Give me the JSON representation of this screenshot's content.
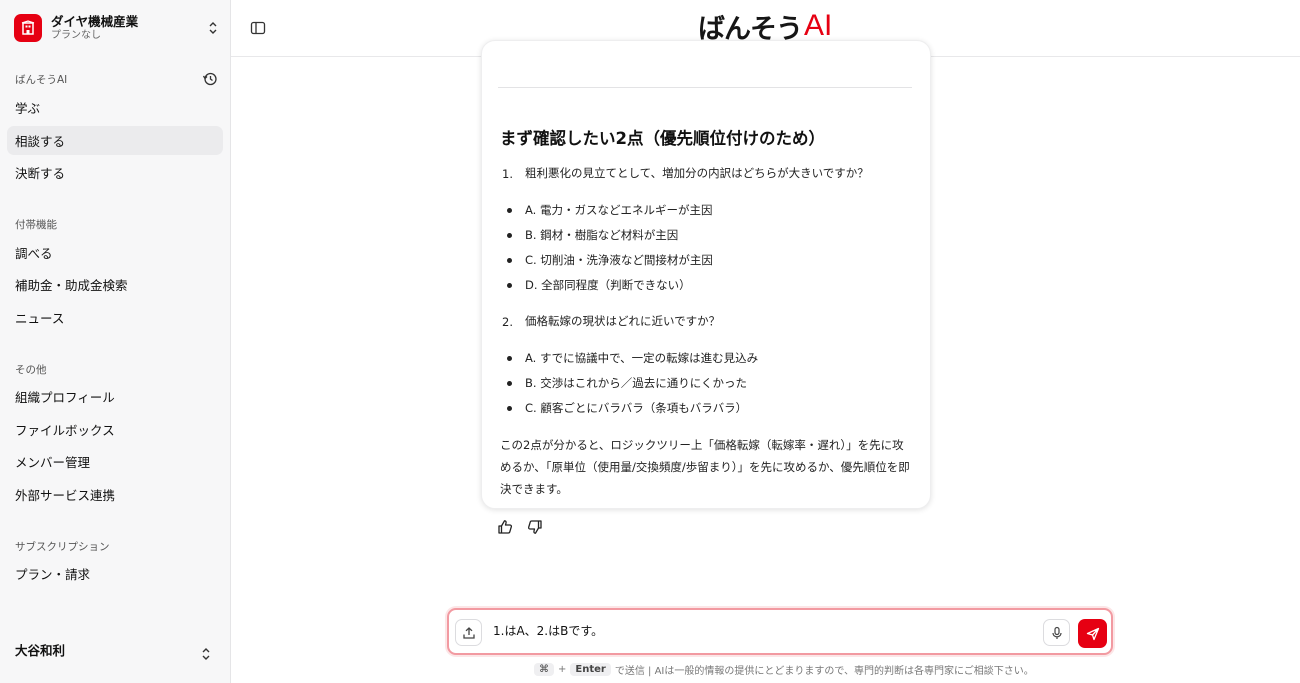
{
  "org": {
    "name": "ダイヤ機械産業",
    "plan": "プランなし"
  },
  "sidebar": {
    "section_main": "ばんそうAI",
    "main_items": [
      {
        "label": "学ぶ"
      },
      {
        "label": "相談する"
      },
      {
        "label": "決断する"
      }
    ],
    "section_extra": "付帯機能",
    "extra_items": [
      {
        "label": "調べる"
      },
      {
        "label": "補助金・助成金検索"
      },
      {
        "label": "ニュース"
      }
    ],
    "section_other": "その他",
    "other_items": [
      {
        "label": "組織プロフィール"
      },
      {
        "label": "ファイルボックス"
      },
      {
        "label": "メンバー管理"
      },
      {
        "label": "外部サービス連携"
      }
    ],
    "section_sub": "サブスクリプション",
    "sub_items": [
      {
        "label": "プラン・請求"
      }
    ],
    "user_name": "大谷和利"
  },
  "header": {
    "brand_kana": "ばんそう",
    "brand_ai": "AI"
  },
  "message": {
    "heading": "まず確認したい2点（優先順位付けのため）",
    "q1_num": "1.",
    "q1": "粗利悪化の見立てとして、増加分の内訳はどちらが大きいですか？",
    "q1_options": [
      "A. 電力・ガスなどエネルギーが主因",
      "B. 鋼材・樹脂など材料が主因",
      "C. 切削油・洗浄液など間接材が主因",
      "D. 全部同程度（判断できない）"
    ],
    "q2_num": "2.",
    "q2": "価格転嫁の現状はどれに近いですか？",
    "q2_options": [
      "A. すでに協議中で、一定の転嫁は進む見込み",
      "B. 交渉はこれから／過去に通りにくかった",
      "C. 顧客ごとにバラバラ（条項もバラバラ）"
    ],
    "closing": "この2点が分かると、ロジックツリー上「価格転嫁（転嫁率・遅れ）」を先に攻めるか、「原単位（使用量/交換頻度/歩留まり）」を先に攻めるか、優先順位を即決できます。"
  },
  "composer": {
    "value": "1.はA、2.はBです。",
    "hint_key1": "⌘",
    "hint_plus": "+",
    "hint_key2": "Enter",
    "hint_text": "で送信 | AIは一般的情報の提供にとどまりますので、専門的判断は各専門家にご相談下さい。"
  },
  "colors": {
    "accent": "#e60012",
    "sidebar_bg": "#f7f7f8",
    "active_item": "#ebebed"
  }
}
